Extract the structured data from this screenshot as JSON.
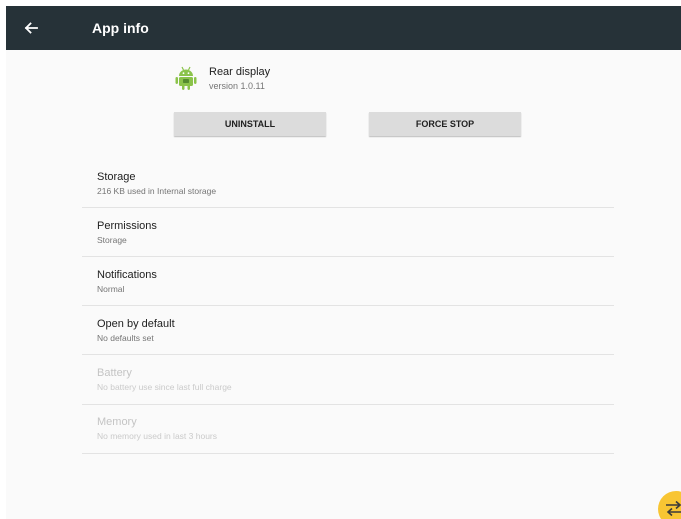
{
  "appbar": {
    "title": "App info",
    "back_icon": "arrow-back-icon",
    "background": "#263238"
  },
  "app": {
    "name": "Rear display",
    "version": "version 1.0.11",
    "icon": "android-robot-icon",
    "icon_color": "#8bc34a"
  },
  "buttons": {
    "uninstall": "UNINSTALL",
    "force_stop": "FORCE STOP"
  },
  "items": [
    {
      "title": "Storage",
      "subtitle": "216 KB used in Internal storage",
      "enabled": true
    },
    {
      "title": "Permissions",
      "subtitle": "Storage",
      "enabled": true
    },
    {
      "title": "Notifications",
      "subtitle": "Normal",
      "enabled": true
    },
    {
      "title": "Open by default",
      "subtitle": "No defaults set",
      "enabled": true
    },
    {
      "title": "Battery",
      "subtitle": "No battery use since last full charge",
      "enabled": false
    },
    {
      "title": "Memory",
      "subtitle": "No memory used in last 3 hours",
      "enabled": false
    }
  ],
  "fab": {
    "icon": "swap-arrows-icon",
    "color": "#f8c533"
  }
}
